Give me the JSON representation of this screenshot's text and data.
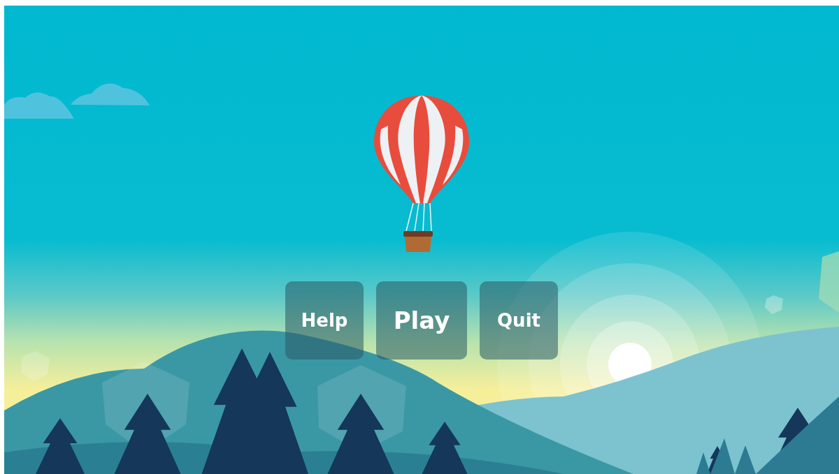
{
  "menu_buttons": [
    {
      "label": "Help",
      "kind": "secondary"
    },
    {
      "label": "Play",
      "kind": "primary"
    },
    {
      "label": "Quit",
      "kind": "secondary"
    }
  ]
}
